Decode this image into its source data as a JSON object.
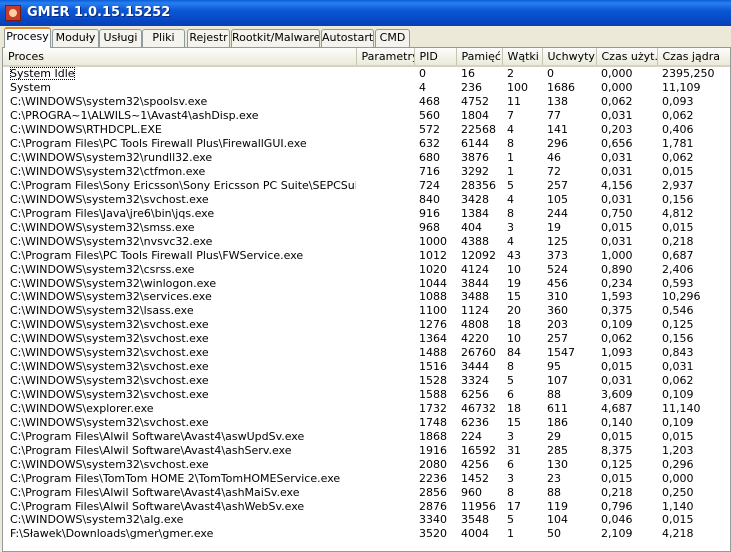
{
  "window": {
    "title": "GMER 1.0.15.15252"
  },
  "tabs": [
    {
      "label": "Procesy",
      "active": true
    },
    {
      "label": "Moduły"
    },
    {
      "label": "Usługi"
    },
    {
      "label": "Pliki"
    },
    {
      "label": "Rejestr"
    },
    {
      "label": "Rootkit/Malware"
    },
    {
      "label": "Autostart"
    },
    {
      "label": "CMD"
    }
  ],
  "table": {
    "columns": [
      "Proces",
      "Parametry",
      "PID",
      "Pamięć",
      "Wątki",
      "Uchwyty",
      "Czas użyt.",
      "Czas jądra"
    ],
    "rows": [
      [
        "System Idle",
        "",
        "0",
        "16",
        "2",
        "0",
        "0,000",
        "2395,250"
      ],
      [
        "System",
        "",
        "4",
        "236",
        "100",
        "1686",
        "0,000",
        "11,109"
      ],
      [
        "C:\\WINDOWS\\system32\\spoolsv.exe",
        "",
        "468",
        "4752",
        "11",
        "138",
        "0,062",
        "0,093"
      ],
      [
        "C:\\PROGRA~1\\ALWILS~1\\Avast4\\ashDisp.exe",
        "",
        "560",
        "1804",
        "7",
        "77",
        "0,031",
        "0,062"
      ],
      [
        "C:\\WINDOWS\\RTHDCPL.EXE",
        "",
        "572",
        "22568",
        "4",
        "141",
        "0,203",
        "0,406"
      ],
      [
        "C:\\Program Files\\PC Tools Firewall Plus\\FirewallGUI.exe",
        "",
        "632",
        "6144",
        "8",
        "296",
        "0,656",
        "1,781"
      ],
      [
        "C:\\WINDOWS\\system32\\rundll32.exe",
        "",
        "680",
        "3876",
        "1",
        "46",
        "0,031",
        "0,062"
      ],
      [
        "C:\\WINDOWS\\system32\\ctfmon.exe",
        "",
        "716",
        "3292",
        "1",
        "72",
        "0,031",
        "0,015"
      ],
      [
        "C:\\Program Files\\Sony Ericsson\\Sony Ericsson PC Suite\\SEPCSuite.exe",
        "",
        "724",
        "28356",
        "5",
        "257",
        "4,156",
        "2,937"
      ],
      [
        "C:\\WINDOWS\\system32\\svchost.exe",
        "",
        "840",
        "3428",
        "4",
        "105",
        "0,031",
        "0,156"
      ],
      [
        "C:\\Program Files\\Java\\jre6\\bin\\jqs.exe",
        "",
        "916",
        "1384",
        "8",
        "244",
        "0,750",
        "4,812"
      ],
      [
        "C:\\WINDOWS\\system32\\smss.exe",
        "",
        "968",
        "404",
        "3",
        "19",
        "0,015",
        "0,015"
      ],
      [
        "C:\\WINDOWS\\system32\\nvsvc32.exe",
        "",
        "1000",
        "4388",
        "4",
        "125",
        "0,031",
        "0,218"
      ],
      [
        "C:\\Program Files\\PC Tools Firewall Plus\\FWService.exe",
        "",
        "1012",
        "12092",
        "43",
        "373",
        "1,000",
        "0,687"
      ],
      [
        "C:\\WINDOWS\\system32\\csrss.exe",
        "",
        "1020",
        "4124",
        "10",
        "524",
        "0,890",
        "2,406"
      ],
      [
        "C:\\WINDOWS\\system32\\winlogon.exe",
        "",
        "1044",
        "3844",
        "19",
        "456",
        "0,234",
        "0,593"
      ],
      [
        "C:\\WINDOWS\\system32\\services.exe",
        "",
        "1088",
        "3488",
        "15",
        "310",
        "1,593",
        "10,296"
      ],
      [
        "C:\\WINDOWS\\system32\\lsass.exe",
        "",
        "1100",
        "1124",
        "20",
        "360",
        "0,375",
        "0,546"
      ],
      [
        "C:\\WINDOWS\\system32\\svchost.exe",
        "",
        "1276",
        "4808",
        "18",
        "203",
        "0,109",
        "0,125"
      ],
      [
        "C:\\WINDOWS\\system32\\svchost.exe",
        "",
        "1364",
        "4220",
        "10",
        "257",
        "0,062",
        "0,156"
      ],
      [
        "C:\\WINDOWS\\system32\\svchost.exe",
        "",
        "1488",
        "26760",
        "84",
        "1547",
        "1,093",
        "0,843"
      ],
      [
        "C:\\WINDOWS\\system32\\svchost.exe",
        "",
        "1516",
        "3444",
        "8",
        "95",
        "0,015",
        "0,031"
      ],
      [
        "C:\\WINDOWS\\system32\\svchost.exe",
        "",
        "1528",
        "3324",
        "5",
        "107",
        "0,031",
        "0,062"
      ],
      [
        "C:\\WINDOWS\\system32\\svchost.exe",
        "",
        "1588",
        "6256",
        "6",
        "88",
        "3,609",
        "0,109"
      ],
      [
        "C:\\WINDOWS\\explorer.exe",
        "",
        "1732",
        "46732",
        "18",
        "611",
        "4,687",
        "11,140"
      ],
      [
        "C:\\WINDOWS\\system32\\svchost.exe",
        "",
        "1748",
        "6236",
        "15",
        "186",
        "0,140",
        "0,109"
      ],
      [
        "C:\\Program Files\\Alwil Software\\Avast4\\aswUpdSv.exe",
        "",
        "1868",
        "224",
        "3",
        "29",
        "0,015",
        "0,015"
      ],
      [
        "C:\\Program Files\\Alwil Software\\Avast4\\ashServ.exe",
        "",
        "1916",
        "16592",
        "31",
        "285",
        "8,375",
        "1,203"
      ],
      [
        "C:\\WINDOWS\\system32\\svchost.exe",
        "",
        "2080",
        "4256",
        "6",
        "130",
        "0,125",
        "0,296"
      ],
      [
        "C:\\Program Files\\TomTom HOME 2\\TomTomHOMEService.exe",
        "",
        "2236",
        "1452",
        "3",
        "23",
        "0,015",
        "0,000"
      ],
      [
        "C:\\Program Files\\Alwil Software\\Avast4\\ashMaiSv.exe",
        "",
        "2856",
        "960",
        "8",
        "88",
        "0,218",
        "0,250"
      ],
      [
        "C:\\Program Files\\Alwil Software\\Avast4\\ashWebSv.exe",
        "",
        "2876",
        "11956",
        "17",
        "119",
        "0,796",
        "1,140"
      ],
      [
        "C:\\WINDOWS\\system32\\alg.exe",
        "",
        "3340",
        "3548",
        "5",
        "104",
        "0,046",
        "0,015"
      ],
      [
        "F:\\Sławek\\Downloads\\gmer\\gmer.exe",
        "",
        "3520",
        "4004",
        "1",
        "50",
        "2,109",
        "4,218"
      ]
    ]
  }
}
